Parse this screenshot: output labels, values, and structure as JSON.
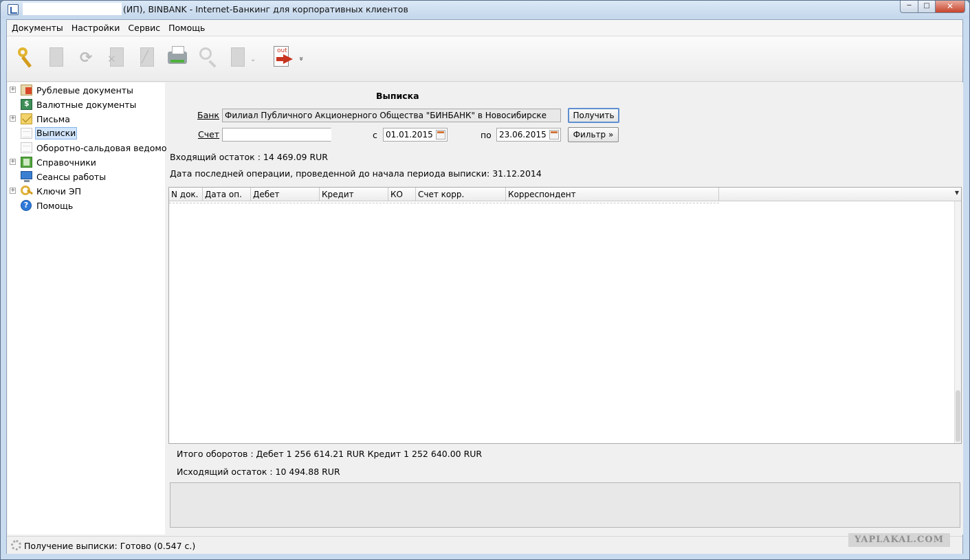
{
  "window": {
    "title": "(ИП), BINBANK - Internet-Банкинг для корпоративных клиентов",
    "min_icon": "─",
    "max_icon": "□",
    "close_icon": "✕"
  },
  "menu": [
    "Документы",
    "Настройки",
    "Сервис",
    "Помощь"
  ],
  "toolbar": {
    "icons": [
      "keys-icon",
      "new-document-icon",
      "refresh-icon",
      "delete-document-icon",
      "edit-document-icon",
      "print-icon",
      "search-icon",
      "import-document-icon",
      "export-out-icon"
    ],
    "out_label": "out",
    "more_label": "»"
  },
  "tree": {
    "items": [
      {
        "label": "Рублевые документы",
        "expander": "+"
      },
      {
        "label": "Валютные документы"
      },
      {
        "label": "Письма",
        "expander": "+"
      },
      {
        "label": "Выписки"
      },
      {
        "label": "Оборотно-сальдовая ведомость"
      },
      {
        "label": "Справочники",
        "expander": "+"
      },
      {
        "label": "Сеансы работы"
      },
      {
        "label": "Ключи ЭП",
        "expander": "+"
      },
      {
        "label": "Помощь",
        "icon_glyph": "?"
      }
    ]
  },
  "statement": {
    "heading": "Выписка",
    "bank_label": "Банк",
    "bank_value": "Филиал Публичного Акционерного Общества \"БИНБАНК\" в Новосибирске",
    "get_button": "Получить",
    "account_label": "Счет",
    "account_value": "",
    "from_label": "с",
    "from_date": "01.01.2015",
    "to_label": "по",
    "to_date": "23.06.2015",
    "filter_button": "Фильтр »",
    "opening_balance": "Входящий остаток :  14 469.09  RUR",
    "last_operation": "Дата последней операции, проведенной до начала периода выписки: 31.12.2014"
  },
  "table": {
    "columns": [
      "N док.",
      "Дата оп.",
      "Дебет",
      "Кредит",
      "КО",
      "Счет корр.",
      "Корреспондент"
    ],
    "menu_icon": "▼"
  },
  "totals": {
    "turnover": "Итого оборотов :  Дебет  1 256 614.21  RUR  Кредит  1 252 640.00  RUR",
    "closing_balance": "Исходящий остаток :  10 494.88  RUR"
  },
  "status": {
    "text": "Получение выписки: Готово (0.547 с.)"
  },
  "watermark": "YAPLAKAL.COM"
}
